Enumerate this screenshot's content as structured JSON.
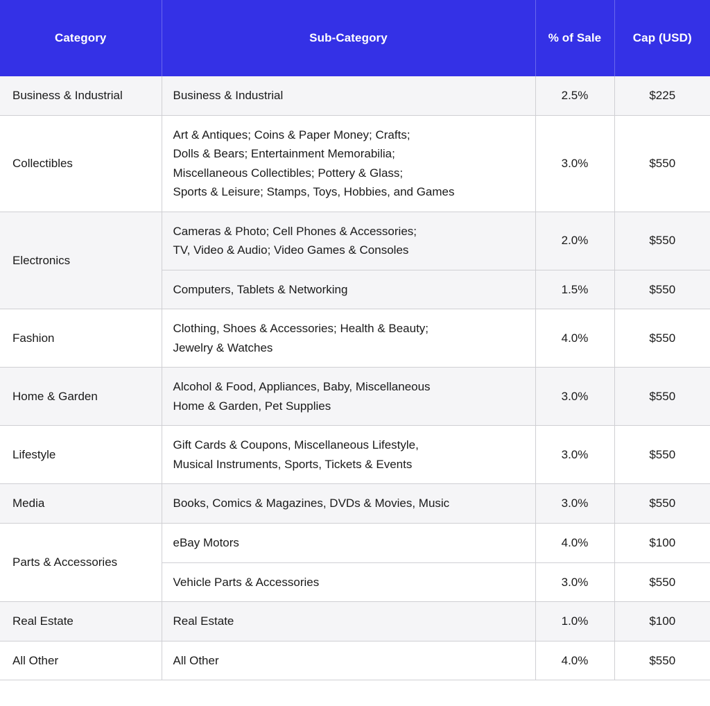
{
  "table": {
    "columns": [
      {
        "key": "category",
        "label": "Category"
      },
      {
        "key": "sub_category",
        "label": "Sub-Category"
      },
      {
        "key": "pct_of_sale",
        "label": "% of Sale"
      },
      {
        "key": "cap_usd",
        "label": "Cap (USD)"
      }
    ],
    "header_background": "#3431e6",
    "header_text_color": "#ffffff",
    "shaded_row_background": "#f5f5f7",
    "plain_row_background": "#ffffff",
    "border_color": "#cfcfd3",
    "groups": [
      {
        "category": "Business & Industrial",
        "shaded": true,
        "rows": [
          {
            "sub_lines": [
              "Business & Industrial"
            ],
            "pct_of_sale": "2.5%",
            "cap_usd": "$225"
          }
        ]
      },
      {
        "category": "Collectibles",
        "shaded": false,
        "rows": [
          {
            "sub_lines": [
              "Art & Antiques; Coins & Paper Money; Crafts;",
              "Dolls & Bears; Entertainment Memorabilia;",
              "Miscellaneous Collectibles; Pottery & Glass;",
              "Sports & Leisure; Stamps, Toys, Hobbies, and Games"
            ],
            "pct_of_sale": "3.0%",
            "cap_usd": "$550"
          }
        ]
      },
      {
        "category": "Electronics",
        "shaded": true,
        "rows": [
          {
            "sub_lines": [
              "Cameras & Photo; Cell Phones & Accessories;",
              "TV, Video & Audio; Video Games & Consoles"
            ],
            "pct_of_sale": "2.0%",
            "cap_usd": "$550"
          },
          {
            "sub_lines": [
              "Computers, Tablets & Networking"
            ],
            "pct_of_sale": "1.5%",
            "cap_usd": "$550"
          }
        ]
      },
      {
        "category": "Fashion",
        "shaded": false,
        "rows": [
          {
            "sub_lines": [
              "Clothing, Shoes & Accessories; Health & Beauty;",
              "Jewelry & Watches"
            ],
            "pct_of_sale": "4.0%",
            "cap_usd": "$550"
          }
        ]
      },
      {
        "category": "Home & Garden",
        "shaded": true,
        "rows": [
          {
            "sub_lines": [
              "Alcohol & Food, Appliances, Baby, Miscellaneous",
              "Home & Garden, Pet Supplies"
            ],
            "pct_of_sale": "3.0%",
            "cap_usd": "$550"
          }
        ]
      },
      {
        "category": "Lifestyle",
        "shaded": false,
        "rows": [
          {
            "sub_lines": [
              "Gift Cards & Coupons, Miscellaneous Lifestyle,",
              "Musical Instruments, Sports, Tickets & Events"
            ],
            "pct_of_sale": "3.0%",
            "cap_usd": "$550"
          }
        ]
      },
      {
        "category": "Media",
        "shaded": true,
        "rows": [
          {
            "sub_lines": [
              "Books, Comics & Magazines, DVDs & Movies, Music"
            ],
            "pct_of_sale": "3.0%",
            "cap_usd": "$550"
          }
        ]
      },
      {
        "category": "Parts & Accessories",
        "shaded": false,
        "rows": [
          {
            "sub_lines": [
              "eBay Motors"
            ],
            "pct_of_sale": "4.0%",
            "cap_usd": "$100"
          },
          {
            "sub_lines": [
              "Vehicle Parts & Accessories"
            ],
            "pct_of_sale": "3.0%",
            "cap_usd": "$550"
          }
        ]
      },
      {
        "category": "Real Estate",
        "shaded": true,
        "rows": [
          {
            "sub_lines": [
              "Real Estate"
            ],
            "pct_of_sale": "1.0%",
            "cap_usd": "$100"
          }
        ]
      },
      {
        "category": "All Other",
        "shaded": false,
        "rows": [
          {
            "sub_lines": [
              "All Other"
            ],
            "pct_of_sale": "4.0%",
            "cap_usd": "$550"
          }
        ]
      }
    ]
  }
}
